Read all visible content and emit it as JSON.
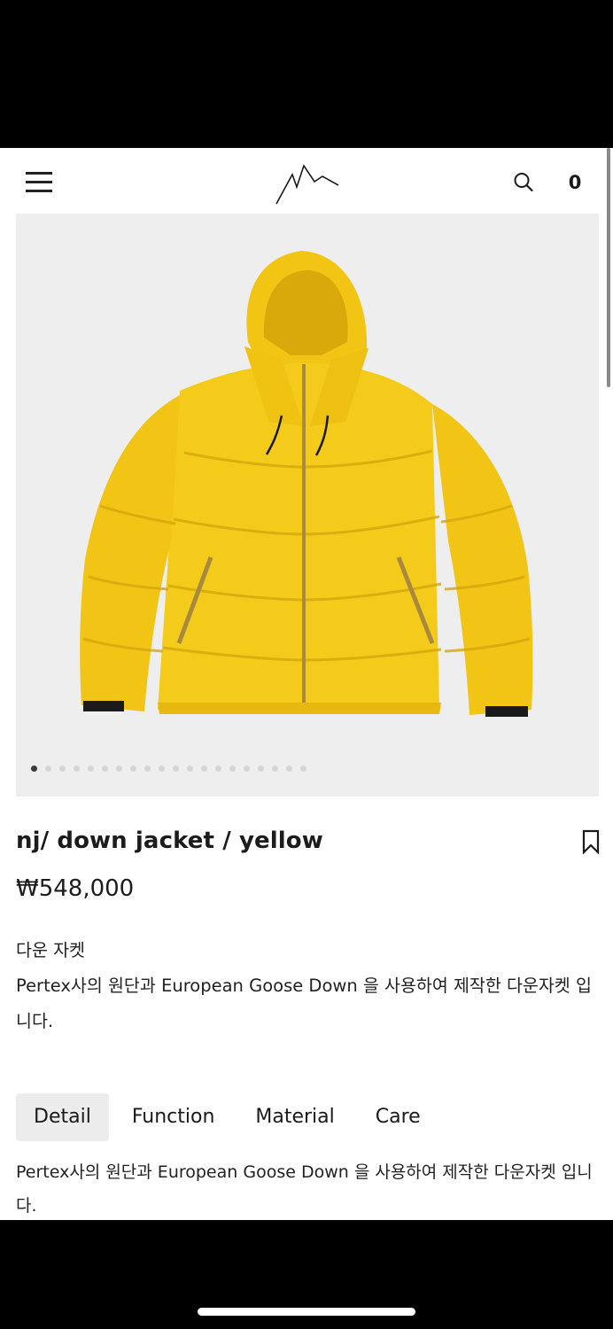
{
  "header": {
    "cart_count": "0"
  },
  "gallery": {
    "slide_count": 20,
    "active_index": 0
  },
  "product": {
    "title": "nj/ down jacket / yellow",
    "price": "₩548,000",
    "description_line1": "다운 자켓",
    "description_line2": "Pertex사의 원단과 European Goose Down 을 사용하여 제작한 다운자켓 입니다."
  },
  "tabs": [
    {
      "label": "Detail",
      "active": true
    },
    {
      "label": "Function",
      "active": false
    },
    {
      "label": "Material",
      "active": false
    },
    {
      "label": "Care",
      "active": false
    }
  ],
  "tab_content": "Pertex사의 원단과 European Goose Down 을 사용하여 제작한 다운자켓 입니다.",
  "colors": {
    "jacket": "#f4cb1a",
    "jacket_shadow": "#d9ab0c",
    "zipper": "#a88a3c",
    "background": "#eeeeee"
  },
  "icons": {
    "menu": "hamburger-icon",
    "logo": "mountain-logo",
    "search": "search-icon",
    "bookmark": "bookmark-icon"
  }
}
